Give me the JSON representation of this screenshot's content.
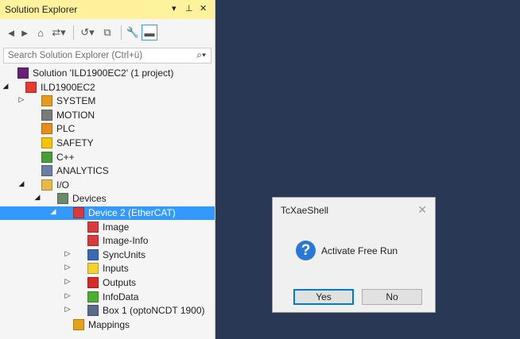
{
  "panel": {
    "title": "Solution Explorer",
    "controls": [
      "▾",
      "⊥",
      "✕"
    ],
    "search_placeholder": "Search Solution Explorer (Ctrl+ü)"
  },
  "tree": [
    {
      "label": "Solution 'ILD1900EC2' (1 project)",
      "icon": "solution-icon",
      "color": "#68217a"
    },
    {
      "label": "ILD1900EC2",
      "icon": "project-icon",
      "color": "#e8392e"
    },
    {
      "label": "SYSTEM",
      "icon": "system-icon",
      "color": "#e89a1a"
    },
    {
      "label": "MOTION",
      "icon": "motion-icon",
      "color": "#7a7a7a"
    },
    {
      "label": "PLC",
      "icon": "plc-icon",
      "color": "#e88d1a"
    },
    {
      "label": "SAFETY",
      "icon": "safety-icon",
      "color": "#f5c400"
    },
    {
      "label": "C++",
      "icon": "cpp-icon",
      "color": "#4a9e3a"
    },
    {
      "label": "ANALYTICS",
      "icon": "analytics-icon",
      "color": "#6b7fa5"
    },
    {
      "label": "I/O",
      "icon": "io-icon",
      "color": "#e8b84a"
    },
    {
      "label": "Devices",
      "icon": "devices-icon",
      "color": "#6a8a6a"
    },
    {
      "label": "Device 2 (EtherCAT)",
      "icon": "ethercat-device-icon",
      "color": "#d83b3b"
    },
    {
      "label": "Image",
      "icon": "image-icon",
      "color": "#d83b3b"
    },
    {
      "label": "Image-Info",
      "icon": "image-info-icon",
      "color": "#d83b3b"
    },
    {
      "label": "SyncUnits",
      "icon": "syncunits-icon",
      "color": "#3a6ab5"
    },
    {
      "label": "Inputs",
      "icon": "inputs-icon",
      "color": "#f2d22e"
    },
    {
      "label": "Outputs",
      "icon": "outputs-icon",
      "color": "#d82a2a"
    },
    {
      "label": "InfoData",
      "icon": "infodata-icon",
      "color": "#4ab02e"
    },
    {
      "label": "Box 1 (optoNCDT 1900)",
      "icon": "box-icon",
      "color": "#5a6a8a"
    },
    {
      "label": "Mappings",
      "icon": "mappings-icon",
      "color": "#e8a21a"
    }
  ],
  "dialog": {
    "title": "TcXaeShell",
    "message": "Activate Free Run",
    "yes_label": "Yes",
    "no_label": "No"
  }
}
